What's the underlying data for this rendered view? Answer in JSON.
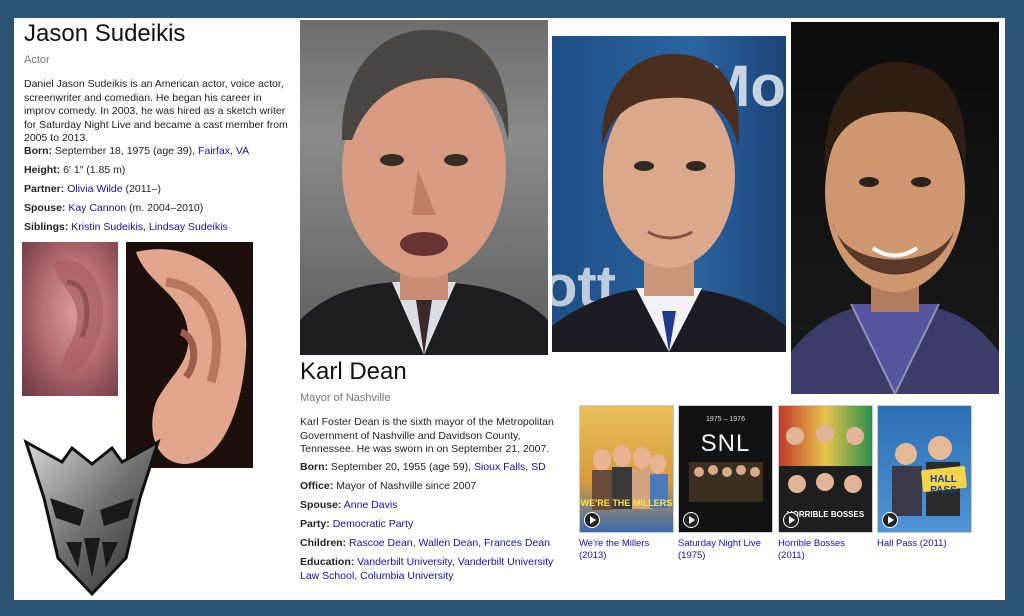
{
  "jason": {
    "name": "Jason Sudeikis",
    "type": "Actor",
    "description": "Daniel Jason Sudeikis is an American actor, voice actor, screenwriter and comedian. He began his career in improv comedy. In 2003, he was hired as a sketch writer for Saturday Night Live and became a cast member from 2005 to 2013.",
    "born_label": "Born:",
    "born_value": "September 18, 1975 (age 39),",
    "born_link": "Fairfax, VA",
    "height_label": "Height:",
    "height_value": "6′ 1″ (1.85 m)",
    "partner_label": "Partner:",
    "partner_link": "Olivia Wilde",
    "partner_value": "(2011–)",
    "spouse_label": "Spouse:",
    "spouse_link": "Kay Cannon",
    "spouse_value": "(m. 2004–2010)",
    "siblings_label": "Siblings:",
    "siblings_link": "Kristin Sudeikis, Lindsay Sudeikis"
  },
  "karl": {
    "name": "Karl Dean",
    "type": "Mayor of Nashville",
    "description": "Karl Foster Dean is the sixth mayor of the Metropolitan Government of Nashville and Davidson County, Tennessee. He was sworn in on September 21, 2007.",
    "born_label": "Born:",
    "born_value": "September 20, 1955 (age 59),",
    "born_link": "Sioux Falls, SD",
    "office_label": "Office:",
    "office_value": "Mayor of Nashville since 2007",
    "spouse_label": "Spouse:",
    "spouse_link": "Anne Davis",
    "party_label": "Party:",
    "party_link": "Democratic Party",
    "children_label": "Children:",
    "children_link": "Rascoe Dean, Wallen Dean, Frances Dean",
    "education_label": "Education:",
    "education_link_1": "Vanderbilt University, Vanderbilt University",
    "education_link_2": "Law School, Columbia University"
  },
  "posters": [
    {
      "caption_1": "We're the Millers",
      "caption_2": "(2013)",
      "art_text": "WE'RE THE MILLERS"
    },
    {
      "caption_1": "Saturday Night Live",
      "caption_2": "(1975)",
      "art_text": "SNL",
      "art_top": "1975 – 1976"
    },
    {
      "caption_1": "Horrible Bosses",
      "caption_2": "(2011)",
      "art_text": "HORRIBLE BOSSES"
    },
    {
      "caption_1": "Hall Pass (2011)",
      "caption_2": "",
      "art_text": "HALL PASS"
    }
  ],
  "colors": {
    "link": "#1a0dab",
    "frame": "#2d5573"
  },
  "icons": {
    "logo": "decepticon-logo-icon",
    "play": "play-icon"
  }
}
